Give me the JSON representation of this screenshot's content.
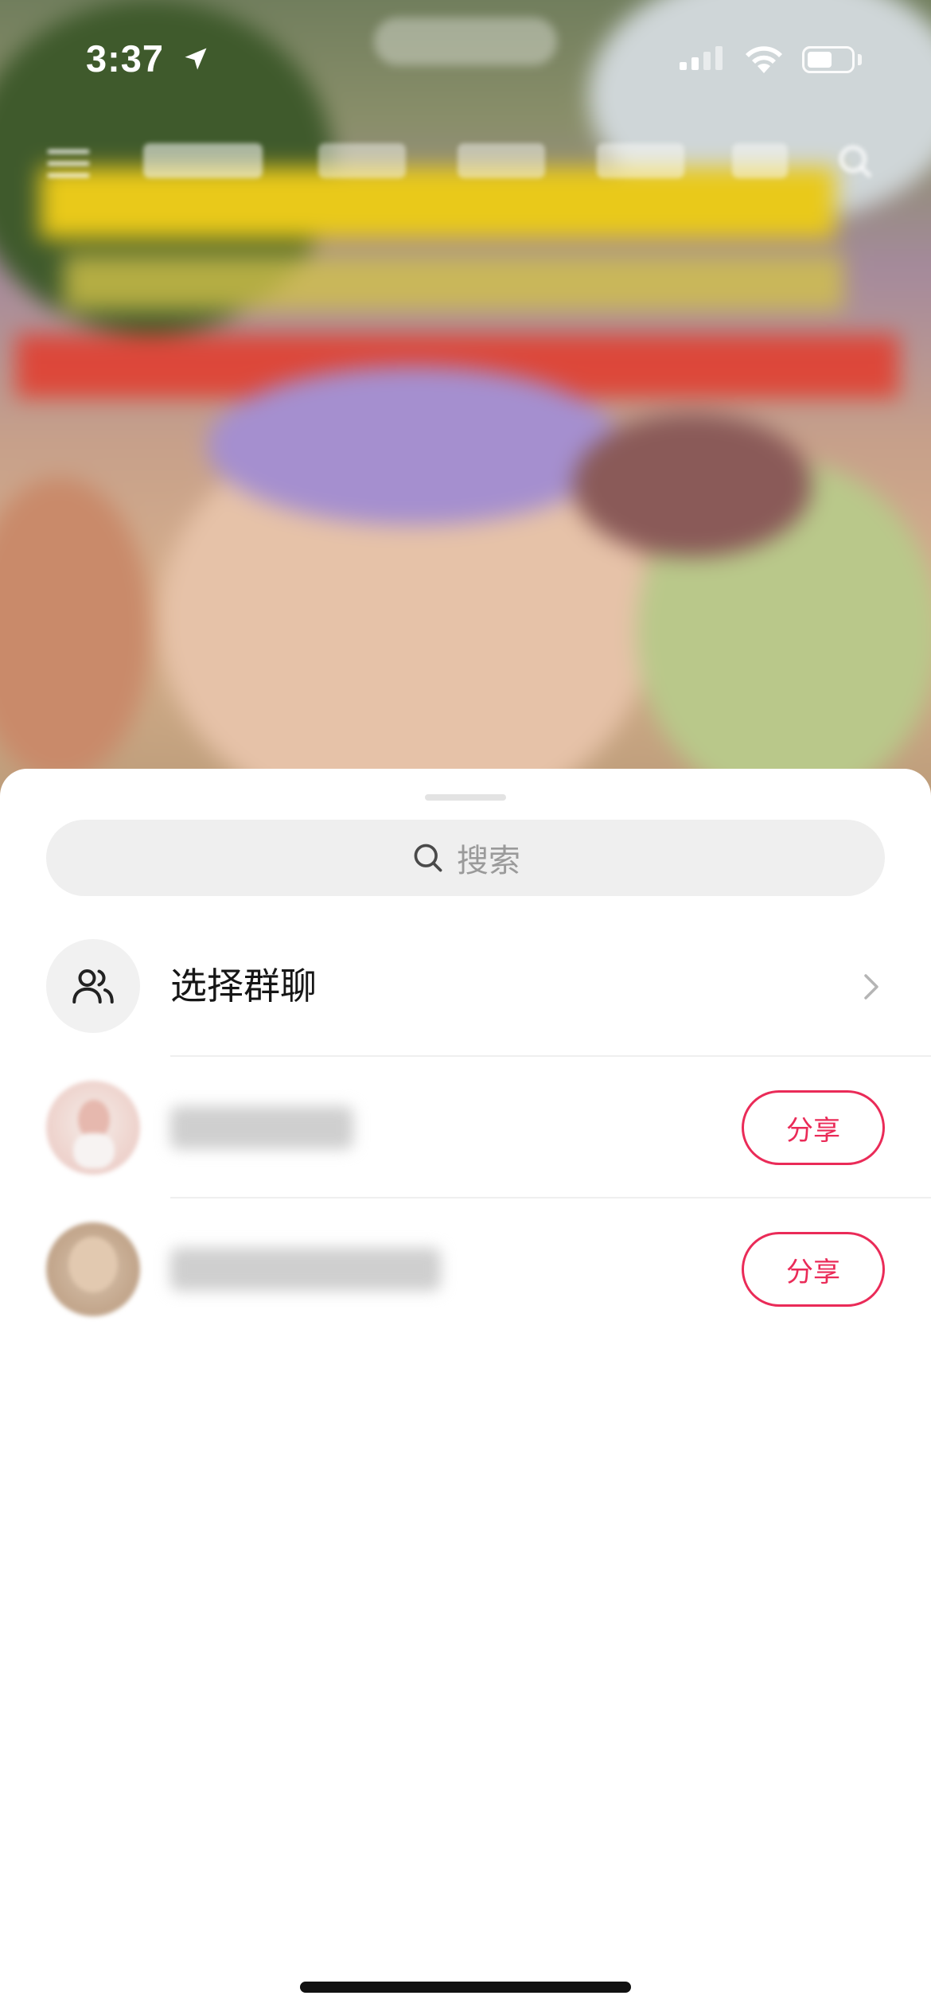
{
  "status_bar": {
    "time": "3:37"
  },
  "share_sheet": {
    "search": {
      "placeholder": "搜索"
    },
    "group_chat": {
      "label": "选择群聊"
    },
    "contacts": [
      {
        "share_label": "分享"
      },
      {
        "share_label": "分享"
      }
    ]
  },
  "colors": {
    "accent": "#ea2b58",
    "search_bg": "#efefef",
    "text_primary": "#161616",
    "text_placeholder": "#9a9a9a"
  },
  "icons": [
    "location-arrow-icon",
    "cellular-signal-icon",
    "wifi-icon",
    "battery-icon",
    "search-icon",
    "group-users-icon",
    "chevron-right-icon"
  ]
}
